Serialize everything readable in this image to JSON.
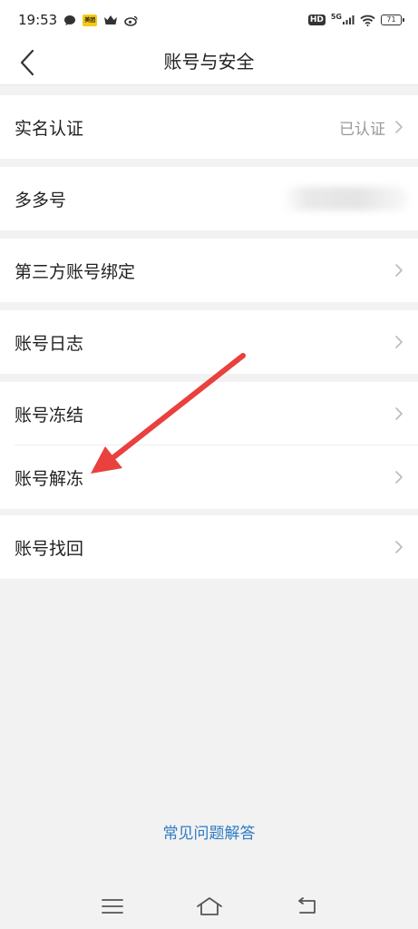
{
  "status_bar": {
    "time": "19:53",
    "left_icons": [
      "chat-bubble-icon",
      "yellow-app-icon",
      "crown-icon",
      "weibo-icon"
    ],
    "yellow_app_label": "美团",
    "hd_label": "HD",
    "network_label": "5G",
    "battery_level": "71"
  },
  "nav": {
    "title": "账号与安全",
    "back_icon": "chevron-left-icon"
  },
  "groups": [
    {
      "rows": [
        {
          "label": "实名认证",
          "value": "已认证",
          "chevron": true
        }
      ]
    },
    {
      "rows": [
        {
          "label": "多多号",
          "value": "",
          "blurred": true,
          "chevron": false
        }
      ]
    },
    {
      "rows": [
        {
          "label": "第三方账号绑定",
          "chevron": true
        }
      ]
    },
    {
      "rows": [
        {
          "label": "账号日志",
          "chevron": true
        }
      ]
    },
    {
      "rows": [
        {
          "label": "账号冻结",
          "chevron": true
        },
        {
          "label": "账号解冻",
          "chevron": true
        }
      ]
    },
    {
      "rows": [
        {
          "label": "账号找回",
          "chevron": true
        }
      ]
    }
  ],
  "faq": {
    "label": "常见问题解答",
    "color": "#2e7cc4"
  },
  "bottom_nav": {
    "icons": [
      "menu-icon",
      "home-icon",
      "back-icon"
    ]
  },
  "annotation": {
    "color": "#e8413e",
    "icon": "red-arrow-icon"
  }
}
